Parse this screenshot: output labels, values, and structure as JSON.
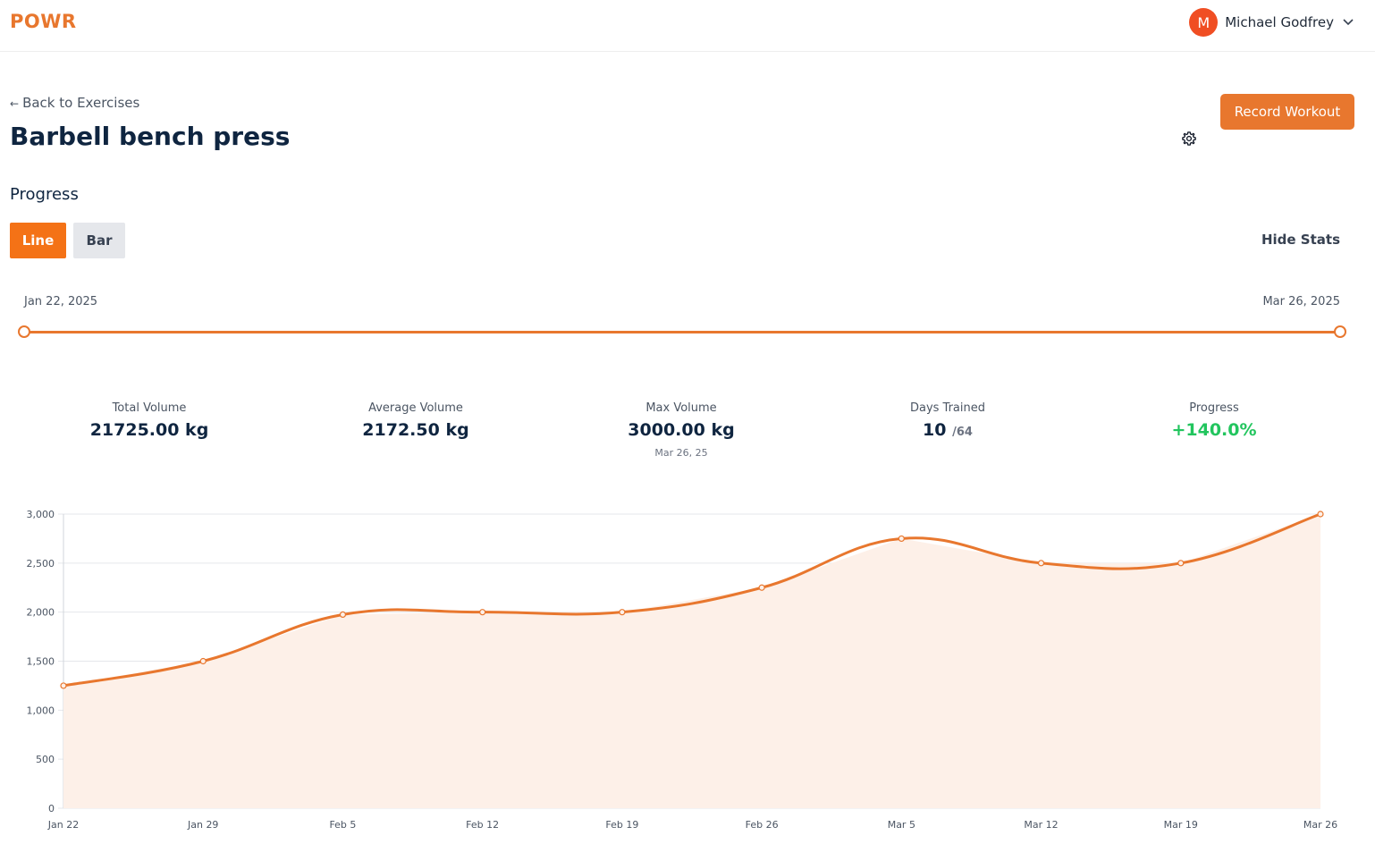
{
  "header": {
    "logo": "POWR",
    "user": {
      "initial": "M",
      "name": "Michael Godfrey"
    }
  },
  "page": {
    "back_label": "Back to Exercises",
    "back_arrow": "←",
    "title": "Barbell bench press",
    "record_button": "Record Workout",
    "settings_icon": "gear-icon"
  },
  "progress": {
    "section_title": "Progress",
    "toggles": {
      "line": "Line",
      "bar": "Bar",
      "active": "line"
    },
    "hide_stats": "Hide Stats",
    "range": {
      "start": "Jan 22, 2025",
      "end": "Mar 26, 2025"
    }
  },
  "stats": {
    "total_volume": {
      "label": "Total Volume",
      "value": "21725.00 kg"
    },
    "average_volume": {
      "label": "Average Volume",
      "value": "2172.50 kg"
    },
    "max_volume": {
      "label": "Max Volume",
      "value": "3000.00 kg",
      "date": "Mar 26, 25"
    },
    "days_trained": {
      "label": "Days Trained",
      "value": "10",
      "denominator": "/64"
    },
    "progress": {
      "label": "Progress",
      "value": "+140.0%"
    }
  },
  "colors": {
    "accent": "#e8772e",
    "area_fill": "#fdf0e8",
    "positive": "#22c55e",
    "avatar": "#f04e23"
  },
  "chart_data": {
    "type": "line",
    "categories": [
      "Jan 22",
      "Jan 29",
      "Feb 5",
      "Feb 12",
      "Feb 19",
      "Feb 26",
      "Mar 5",
      "Mar 12",
      "Mar 19",
      "Mar 26"
    ],
    "series": [
      {
        "values": [
          1250,
          1500,
          1975,
          2000,
          2000,
          2250,
          2750,
          2500,
          2500,
          3000
        ]
      }
    ],
    "yticks": [
      "0",
      "500",
      "1,000",
      "1,500",
      "2,000",
      "2,500",
      "3,000"
    ],
    "ylim": [
      0,
      3000
    ],
    "grid": true,
    "area_fill": true
  }
}
